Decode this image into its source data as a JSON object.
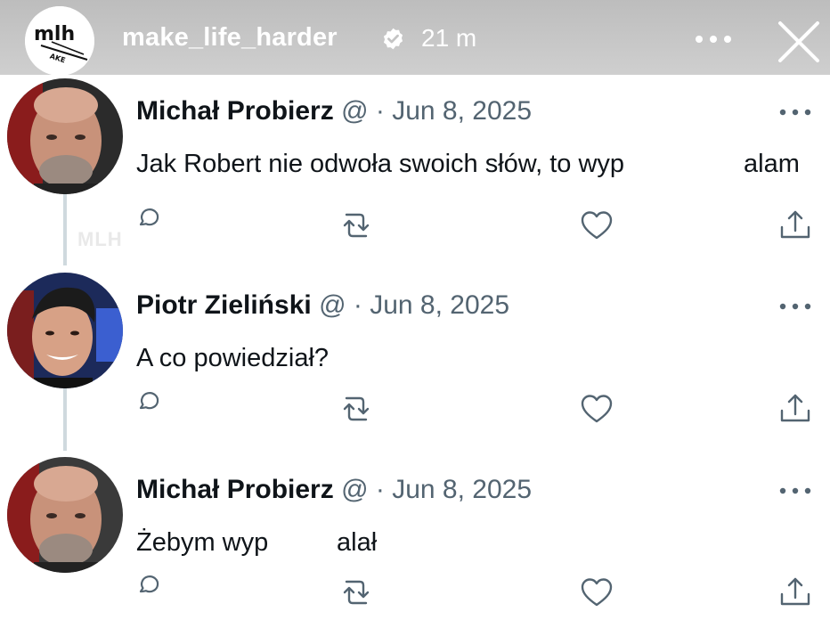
{
  "story": {
    "username": "make_life_harder",
    "time": "21 m",
    "avatar_logo_text": "mlh"
  },
  "watermark": "MLH",
  "tweets": [
    {
      "author": "Michał Probierz",
      "handle": "@",
      "separator": "·",
      "date": "Jun 8, 2025",
      "text_part1": "Jak Robert nie odwoła swoich słów, to wyp",
      "text_part2": "alam"
    },
    {
      "author": "Piotr Zieliński",
      "handle": "@",
      "separator": "·",
      "date": "Jun 8, 2025",
      "text_part1": "A co powiedział?",
      "text_part2": ""
    },
    {
      "author": "Michał Probierz",
      "handle": "@",
      "separator": "·",
      "date": "Jun 8, 2025",
      "text_part1": "Żebym wyp",
      "text_part2": "alał"
    }
  ],
  "icons": {
    "reply": "reply-icon",
    "retweet": "retweet-icon",
    "like": "heart-icon",
    "share": "share-icon",
    "more": "more-horizontal-icon",
    "close": "close-icon",
    "verified": "verified-badge-icon"
  },
  "colors": {
    "text_primary": "#0f1419",
    "text_secondary": "#536471",
    "icon": "#536471",
    "thread_line": "#cfd9de",
    "header_bg": "#c4c4c4"
  }
}
